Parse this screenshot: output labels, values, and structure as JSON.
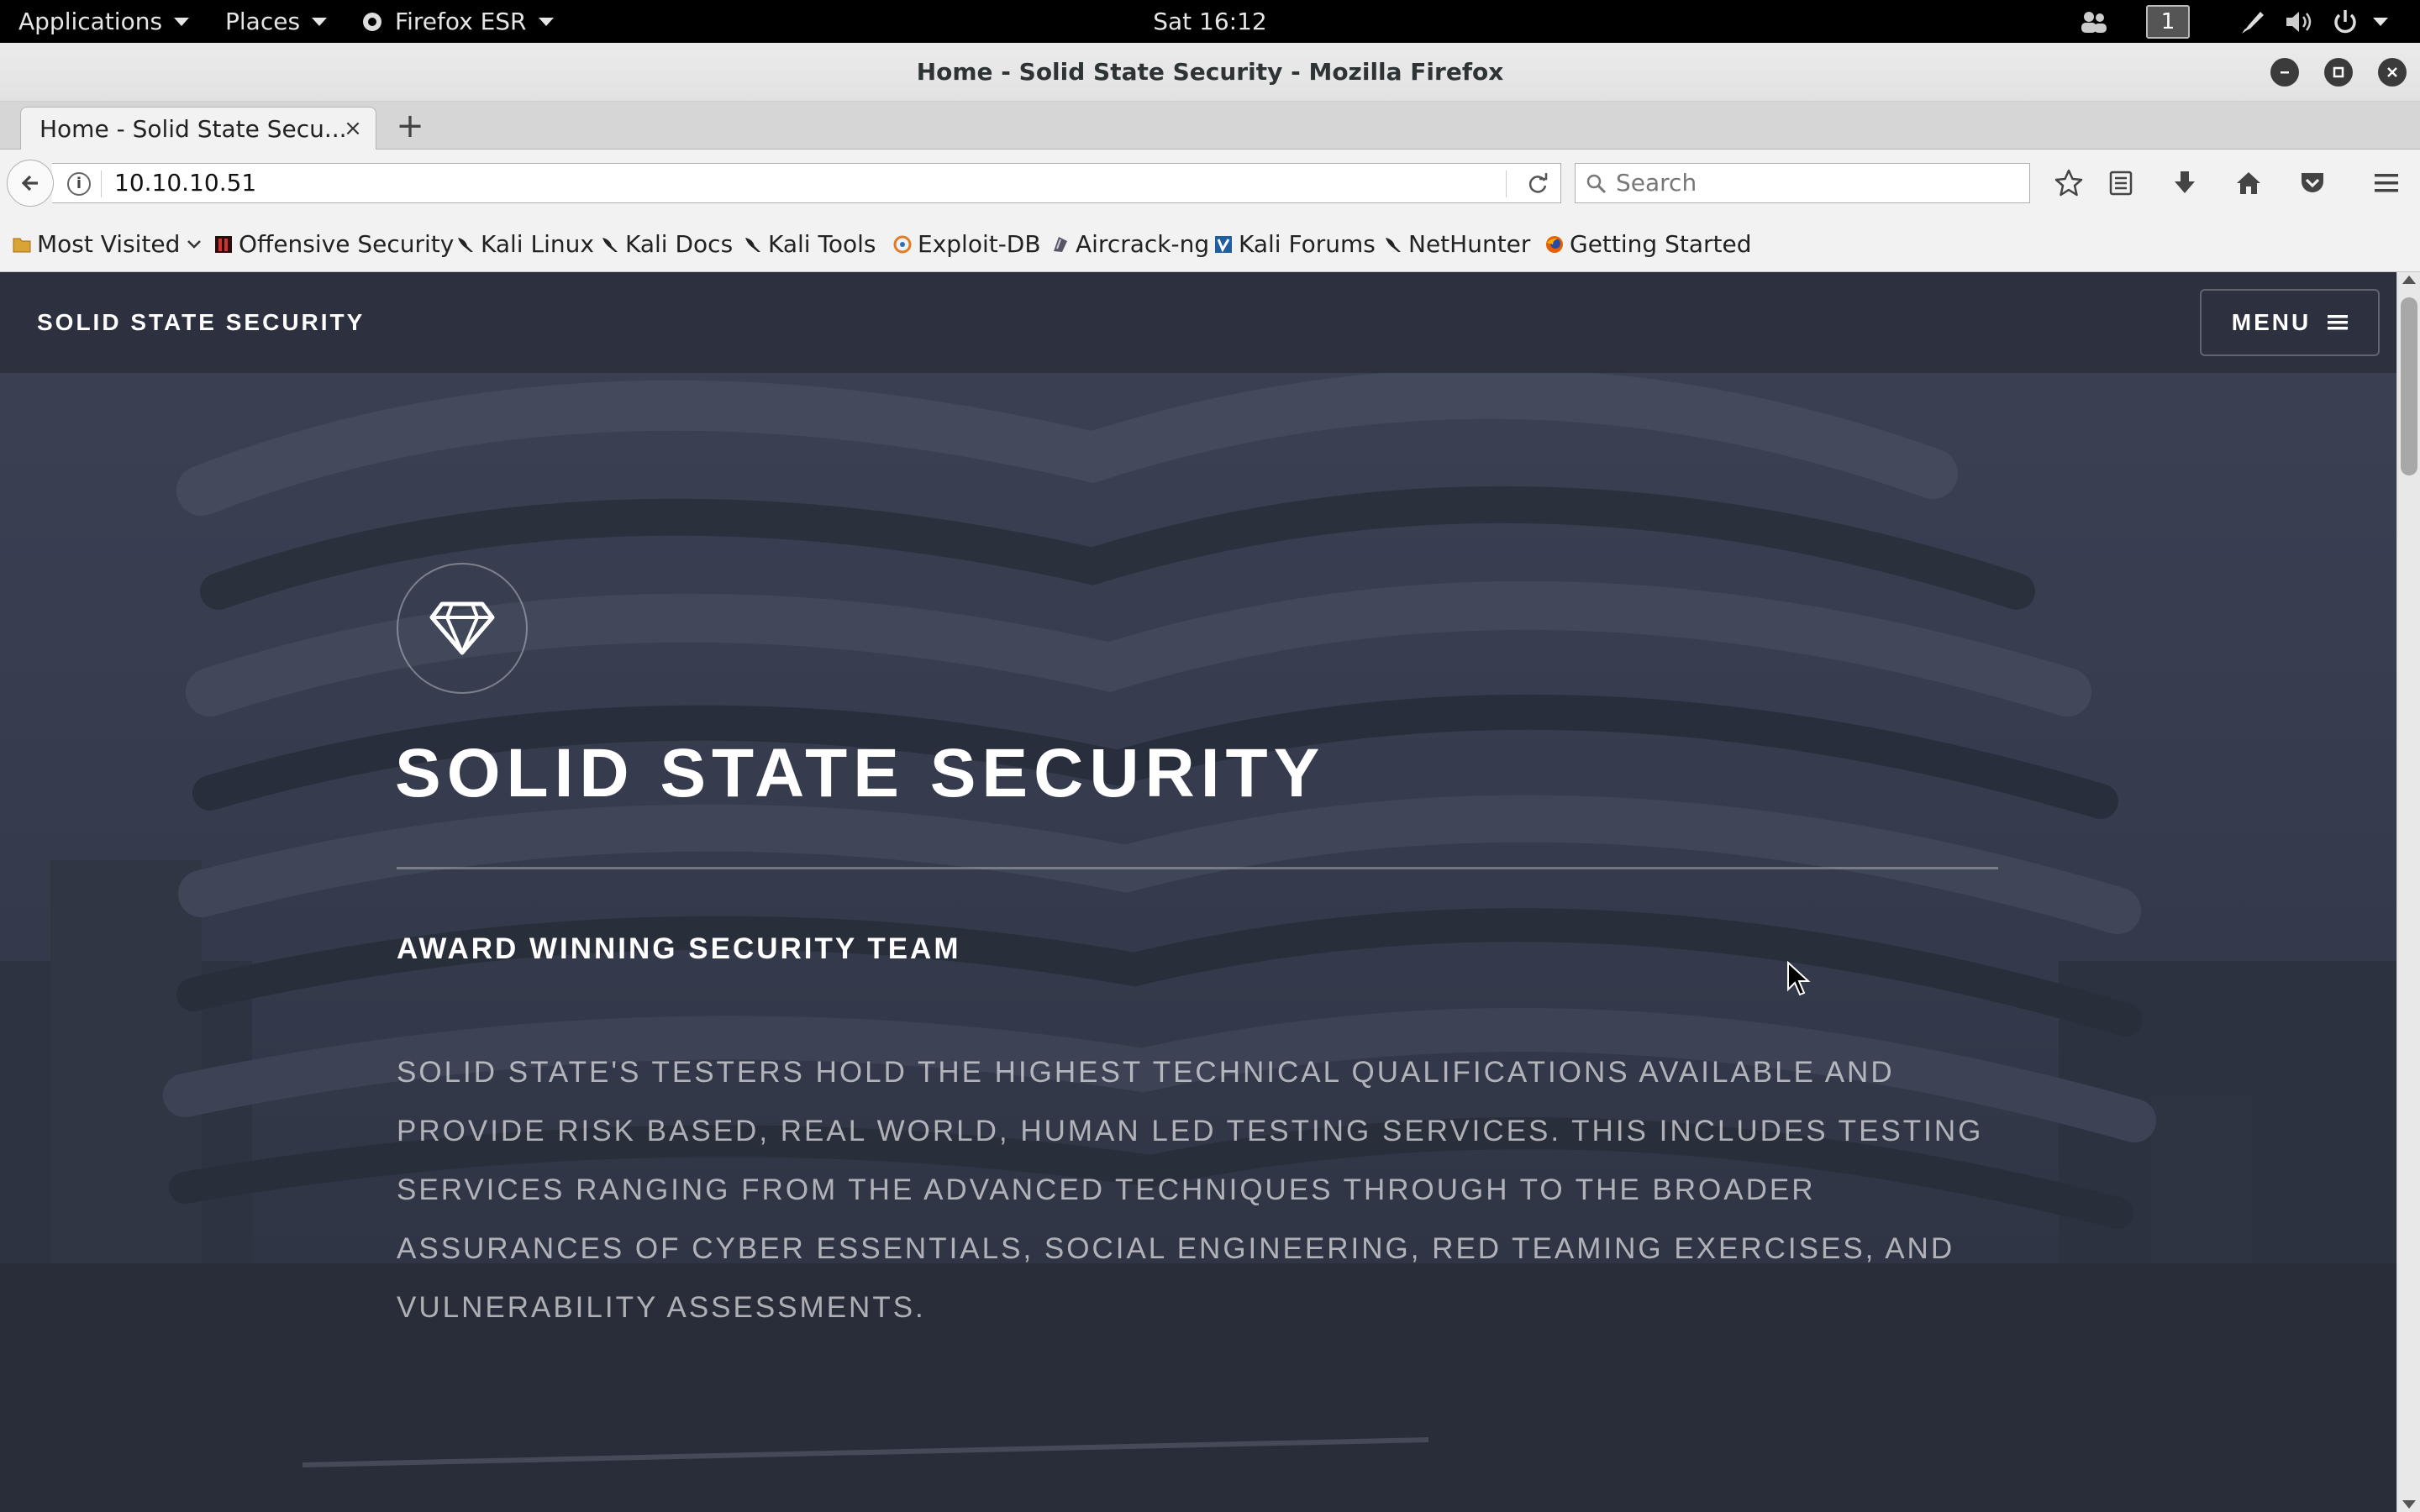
{
  "topbar": {
    "applications": "Applications",
    "places": "Places",
    "firefox_menu": "Firefox ESR",
    "clock": "Sat 16:12",
    "workspace": "1"
  },
  "window": {
    "title": "Home - Solid State Security - Mozilla Firefox"
  },
  "tabs": [
    {
      "label": "Home - Solid State Secu...",
      "close": "×"
    }
  ],
  "newtab_label": "+",
  "navbar": {
    "url": "10.10.10.51",
    "search_placeholder": "Search"
  },
  "bookmarks": [
    {
      "label": "Most Visited",
      "icon": "folder-icon"
    },
    {
      "label": "Offensive Security",
      "icon": "offsec-icon"
    },
    {
      "label": "Kali Linux",
      "icon": "kali-dragon-icon"
    },
    {
      "label": "Kali Docs",
      "icon": "kali-dragon-icon"
    },
    {
      "label": "Kali Tools",
      "icon": "kali-dragon-icon"
    },
    {
      "label": "Exploit-DB",
      "icon": "exploitdb-icon"
    },
    {
      "label": "Aircrack-ng",
      "icon": "aircrack-icon"
    },
    {
      "label": "Kali Forums",
      "icon": "kali-forums-icon"
    },
    {
      "label": "NetHunter",
      "icon": "kali-dragon-icon"
    },
    {
      "label": "Getting Started",
      "icon": "firefox-icon"
    }
  ],
  "site": {
    "brand": "SOLID STATE SECURITY",
    "menu_label": "MENU",
    "hero_title": "SOLID STATE SECURITY",
    "hero_subtitle": "AWARD WINNING SECURITY TEAM",
    "hero_body": "Solid State's testers hold the highest technical qualifications available and provide risk based, real world, human led testing services. This includes testing services ranging from the advanced techniques through to the broader assurances of Cyber Essentials, Social Engineering, Red Teaming exercises, and Vulnerability Assessments."
  },
  "colors": {
    "topbar_bg": "#000000",
    "site_header_bg": "#2c303e",
    "hero_overlay": "#343848"
  }
}
